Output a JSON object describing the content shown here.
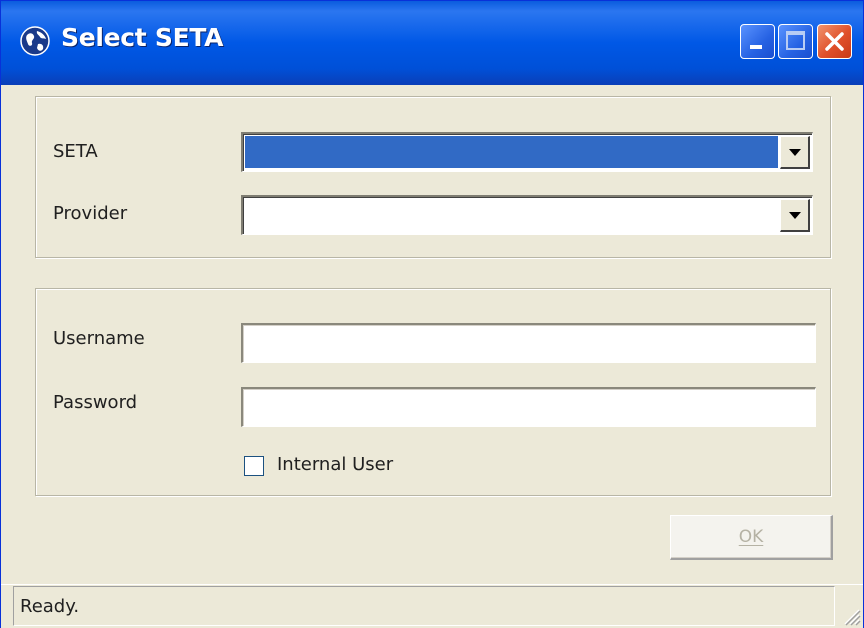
{
  "window": {
    "title": "Select SETA",
    "icon": "globe-icon"
  },
  "title_buttons": {
    "minimize": "minimize-icon",
    "maximize": "maximize-icon",
    "close": "close-icon"
  },
  "selection_group": {
    "seta": {
      "label": "SETA",
      "value": "",
      "state": "selected-highlight"
    },
    "provider": {
      "label": "Provider",
      "value": ""
    }
  },
  "login_group": {
    "username": {
      "label": "Username",
      "value": "",
      "placeholder": ""
    },
    "password": {
      "label": "Password",
      "value": "",
      "placeholder": ""
    },
    "internal_user": {
      "label": "Internal User",
      "checked": false
    }
  },
  "actions": {
    "ok_label": "OK",
    "ok_enabled": false
  },
  "status": {
    "text": "Ready."
  },
  "colors": {
    "title_bar": "#0058e6",
    "window_bg": "#ece9d8",
    "selection_highlight": "#316ac5",
    "close_button": "#e0502a"
  }
}
